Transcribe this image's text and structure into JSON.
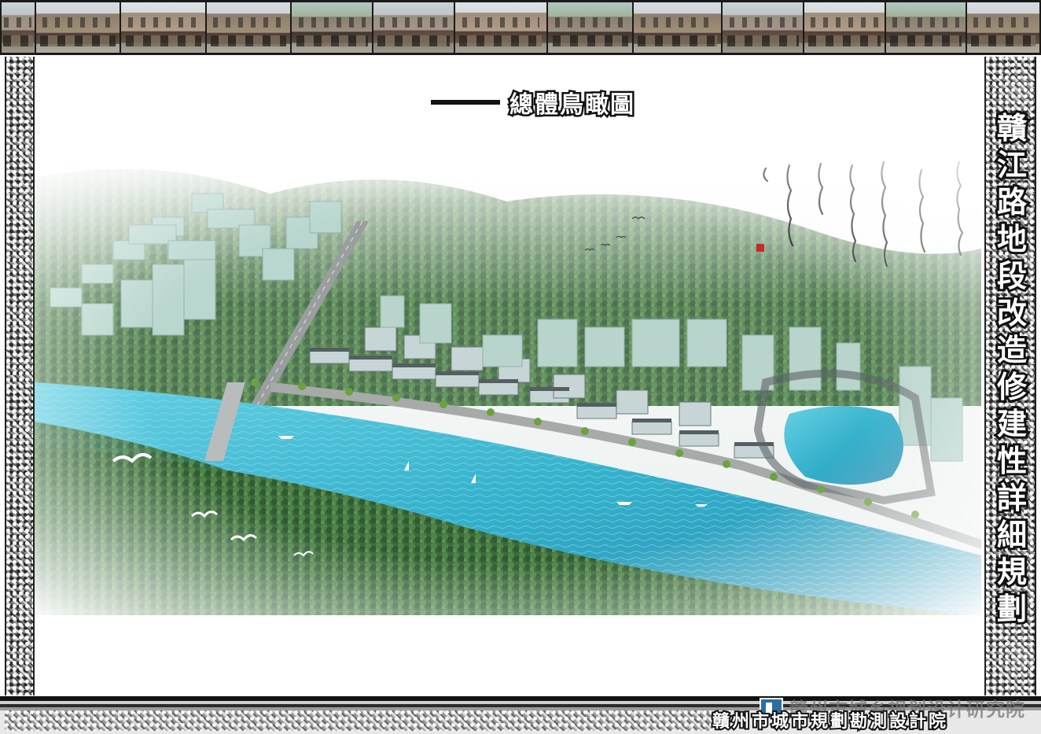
{
  "document": {
    "main_title": "總體鳥瞰圖",
    "vertical_title": "贛江路地段改造修建性詳細規劃",
    "institute_name_top": "赣州市城乡规划设计研究院",
    "institute_name_main": "贛州市城市規劃勘測設計院"
  },
  "colors": {
    "river": "#3fb6cf",
    "forest": "#2f5a33",
    "frame_dark": "#111111"
  },
  "icons": {
    "logo": "institute-logo-icon",
    "seal": "red-seal-stamp"
  }
}
